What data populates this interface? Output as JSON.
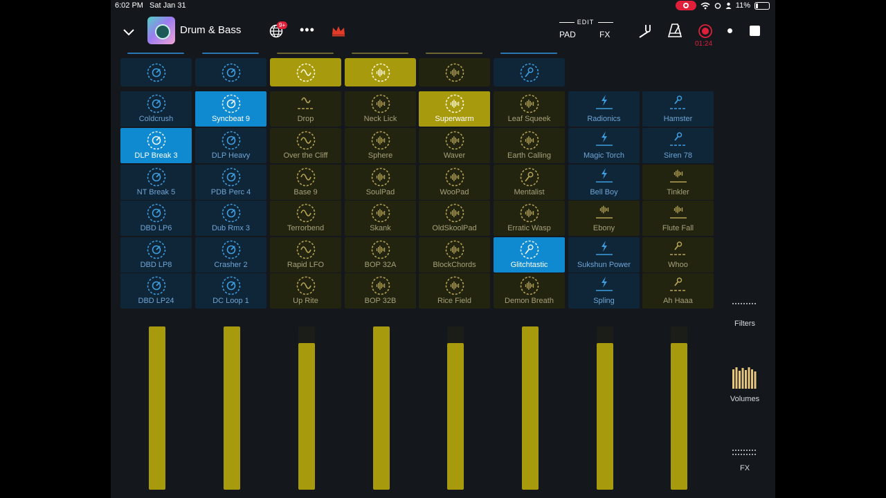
{
  "status": {
    "time": "6:02 PM",
    "date": "Sat Jan 31",
    "battery": "11%"
  },
  "header": {
    "project_title": "Drum & Bass",
    "notification_badge": "9+",
    "edit_label": "EDIT",
    "pad_tab": "PAD",
    "fx_tab": "FX",
    "record_time": "01:24"
  },
  "colors": {
    "blue": "#0f8ad0",
    "gold": "#a89a0d",
    "record_red": "#e0203a"
  },
  "columns": [
    {
      "theme": "blue",
      "header_icon": "dial-icon",
      "header_active": false
    },
    {
      "theme": "blue",
      "header_icon": "dial-icon",
      "header_active": false
    },
    {
      "theme": "gold",
      "header_icon": "wave-icon",
      "header_active": true
    },
    {
      "theme": "gold",
      "header_icon": "bars-icon",
      "header_active": true
    },
    {
      "theme": "gold",
      "header_icon": "bars-icon",
      "header_active": false
    },
    {
      "theme": "blue",
      "header_icon": "mic-icon",
      "header_active": false
    },
    {
      "theme": "none",
      "header_icon": "",
      "header_active": false
    },
    {
      "theme": "none",
      "header_icon": "",
      "header_active": false
    }
  ],
  "pads": [
    [
      {
        "label": "Coldcrush",
        "theme": "blue",
        "icon": "dial-icon",
        "active": false
      },
      {
        "label": "DLP Break 3",
        "theme": "blue",
        "icon": "dial-icon",
        "active": true
      },
      {
        "label": "NT Break 5",
        "theme": "blue",
        "icon": "dial-icon",
        "active": false
      },
      {
        "label": "DBD LP6",
        "theme": "blue",
        "icon": "dial-icon",
        "active": false
      },
      {
        "label": "DBD LP8",
        "theme": "blue",
        "icon": "dial-icon",
        "active": false
      },
      {
        "label": "DBD LP24",
        "theme": "blue",
        "icon": "dial-icon",
        "active": false
      }
    ],
    [
      {
        "label": "Syncbeat 9",
        "theme": "blue",
        "icon": "dial-icon",
        "active": true
      },
      {
        "label": "DLP Heavy",
        "theme": "blue",
        "icon": "dial-icon",
        "active": false
      },
      {
        "label": "PDB Perc 4",
        "theme": "blue",
        "icon": "dial-icon",
        "active": false
      },
      {
        "label": "Dub Rmx 3",
        "theme": "blue",
        "icon": "dial-icon",
        "active": false
      },
      {
        "label": "Crasher 2",
        "theme": "blue",
        "icon": "dial-icon",
        "active": false
      },
      {
        "label": "DC Loop 1",
        "theme": "blue",
        "icon": "dial-icon",
        "active": false
      }
    ],
    [
      {
        "label": "Drop",
        "theme": "gold",
        "icon": "wave-line-icon",
        "active": false
      },
      {
        "label": "Over the Cliff",
        "theme": "gold",
        "icon": "wave-icon",
        "active": false
      },
      {
        "label": "Base 9",
        "theme": "gold",
        "icon": "wave-icon",
        "active": false
      },
      {
        "label": "Terrorbend",
        "theme": "gold",
        "icon": "wave-icon",
        "active": false
      },
      {
        "label": "Rapid LFO",
        "theme": "gold",
        "icon": "wave-icon",
        "active": false
      },
      {
        "label": "Up Rite",
        "theme": "gold",
        "icon": "wave-icon",
        "active": false
      }
    ],
    [
      {
        "label": "Neck Lick",
        "theme": "gold",
        "icon": "bars-icon",
        "active": false
      },
      {
        "label": "Sphere",
        "theme": "gold",
        "icon": "bars-icon",
        "active": false
      },
      {
        "label": "SoulPad",
        "theme": "gold",
        "icon": "bars-icon",
        "active": false
      },
      {
        "label": "Skank",
        "theme": "gold",
        "icon": "bars-icon",
        "active": false
      },
      {
        "label": "BOP 32A",
        "theme": "gold",
        "icon": "bars-icon",
        "active": false
      },
      {
        "label": "BOP 32B",
        "theme": "gold",
        "icon": "bars-icon",
        "active": false
      }
    ],
    [
      {
        "label": "Superwarm",
        "theme": "gold",
        "icon": "bars-icon",
        "active": true
      },
      {
        "label": "Waver",
        "theme": "gold",
        "icon": "bars-icon",
        "active": false
      },
      {
        "label": "WooPad",
        "theme": "gold",
        "icon": "bars-icon",
        "active": false
      },
      {
        "label": "OldSkoolPad",
        "theme": "gold",
        "icon": "bars-icon",
        "active": false
      },
      {
        "label": "BlockChords",
        "theme": "gold",
        "icon": "bars-icon",
        "active": false
      },
      {
        "label": "Rice Field",
        "theme": "gold",
        "icon": "bars-icon",
        "active": false
      }
    ],
    [
      {
        "label": "Leaf Squeek",
        "theme": "gold",
        "icon": "bars-icon",
        "active": false
      },
      {
        "label": "Earth Calling",
        "theme": "gold",
        "icon": "bars-icon",
        "active": false
      },
      {
        "label": "Mentalist",
        "theme": "gold",
        "icon": "mic-icon",
        "active": false
      },
      {
        "label": "Erratic Wasp",
        "theme": "gold",
        "icon": "bars-icon",
        "active": false
      },
      {
        "label": "Glitchtastic",
        "theme": "blue",
        "icon": "mic-icon",
        "active": true
      },
      {
        "label": "Demon Breath",
        "theme": "gold",
        "icon": "bars-icon",
        "active": false
      }
    ],
    [
      {
        "label": "Radionics",
        "theme": "blue",
        "icon": "bolt-line-icon",
        "active": false
      },
      {
        "label": "Magic Torch",
        "theme": "blue",
        "icon": "bolt-line-icon",
        "active": false
      },
      {
        "label": "Bell Boy",
        "theme": "blue",
        "icon": "bolt-line-icon",
        "active": false
      },
      {
        "label": "Ebony",
        "theme": "gold",
        "icon": "bars-line-icon",
        "active": false
      },
      {
        "label": "Sukshun Power",
        "theme": "blue",
        "icon": "bolt-line-icon",
        "active": false
      },
      {
        "label": "Spling",
        "theme": "blue",
        "icon": "bolt-line-icon",
        "active": false
      }
    ],
    [
      {
        "label": "Hamster",
        "theme": "blue",
        "icon": "mic-line-icon",
        "active": false
      },
      {
        "label": "Siren 78",
        "theme": "blue",
        "icon": "mic-line-icon",
        "active": false
      },
      {
        "label": "Tinkler",
        "theme": "gold",
        "icon": "bars-line-icon",
        "active": false
      },
      {
        "label": "Flute Fall",
        "theme": "gold",
        "icon": "bars-line-icon",
        "active": false
      },
      {
        "label": "Whoo",
        "theme": "gold",
        "icon": "mic-line-icon",
        "active": false
      },
      {
        "label": "Ah Haaa",
        "theme": "gold",
        "icon": "mic-line-icon",
        "active": false
      }
    ]
  ],
  "volumes": [
    1.0,
    1.0,
    0.9,
    1.0,
    0.9,
    1.0,
    0.9,
    0.9
  ],
  "side_panel": {
    "filters_label": "Filters",
    "volumes_label": "Volumes",
    "fx_label": "FX"
  }
}
